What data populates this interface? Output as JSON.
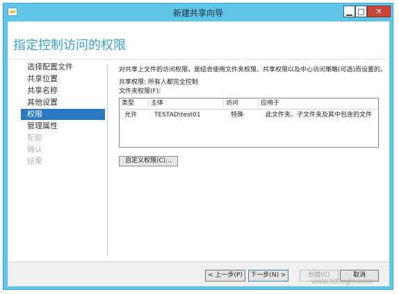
{
  "window": {
    "title": "新建共享向导"
  },
  "titlebar": {
    "minimize": "▁",
    "maximize": "□",
    "close": "✕"
  },
  "header": {
    "title": "指定控制访问的权限"
  },
  "nav": {
    "items": [
      {
        "label": "选择配置文件",
        "state": "normal"
      },
      {
        "label": "共享位置",
        "state": "normal"
      },
      {
        "label": "共享名称",
        "state": "normal"
      },
      {
        "label": "其他设置",
        "state": "normal"
      },
      {
        "label": "权限",
        "state": "active"
      },
      {
        "label": "管理属性",
        "state": "normal"
      },
      {
        "label": "配额",
        "state": "disabled"
      },
      {
        "label": "确认",
        "state": "disabled"
      },
      {
        "label": "结果",
        "state": "disabled"
      }
    ]
  },
  "content": {
    "description": "对共享上文件的访问权限，是结合使用文件夹权限、共享权限以及中心访问策略(可选)而设置的。",
    "share_permissions": "共享权限: 所有人都完全控制",
    "folder_permissions_label": "文件夹权限(F):",
    "columns": [
      "类型",
      "主体",
      "访问",
      "应用于"
    ],
    "rows": [
      {
        "type": "允许",
        "principal": "TESTAD\\test01",
        "access": "特殊",
        "applies_to": "此文件夹、子文件夹及其中包含的文件"
      }
    ],
    "custom_button": "自定义权限(C)..."
  },
  "footer": {
    "prev": "< 上一步(P)",
    "next": "下一步(N) >",
    "create": "创建(C)",
    "cancel": "取消"
  },
  "watermark": "www.lidongni.com",
  "colors": {
    "titlebar": "#5fc4e6",
    "header_title": "#3a9fcc",
    "nav_active": "#2a78c2",
    "close_button": "#c7463a"
  }
}
